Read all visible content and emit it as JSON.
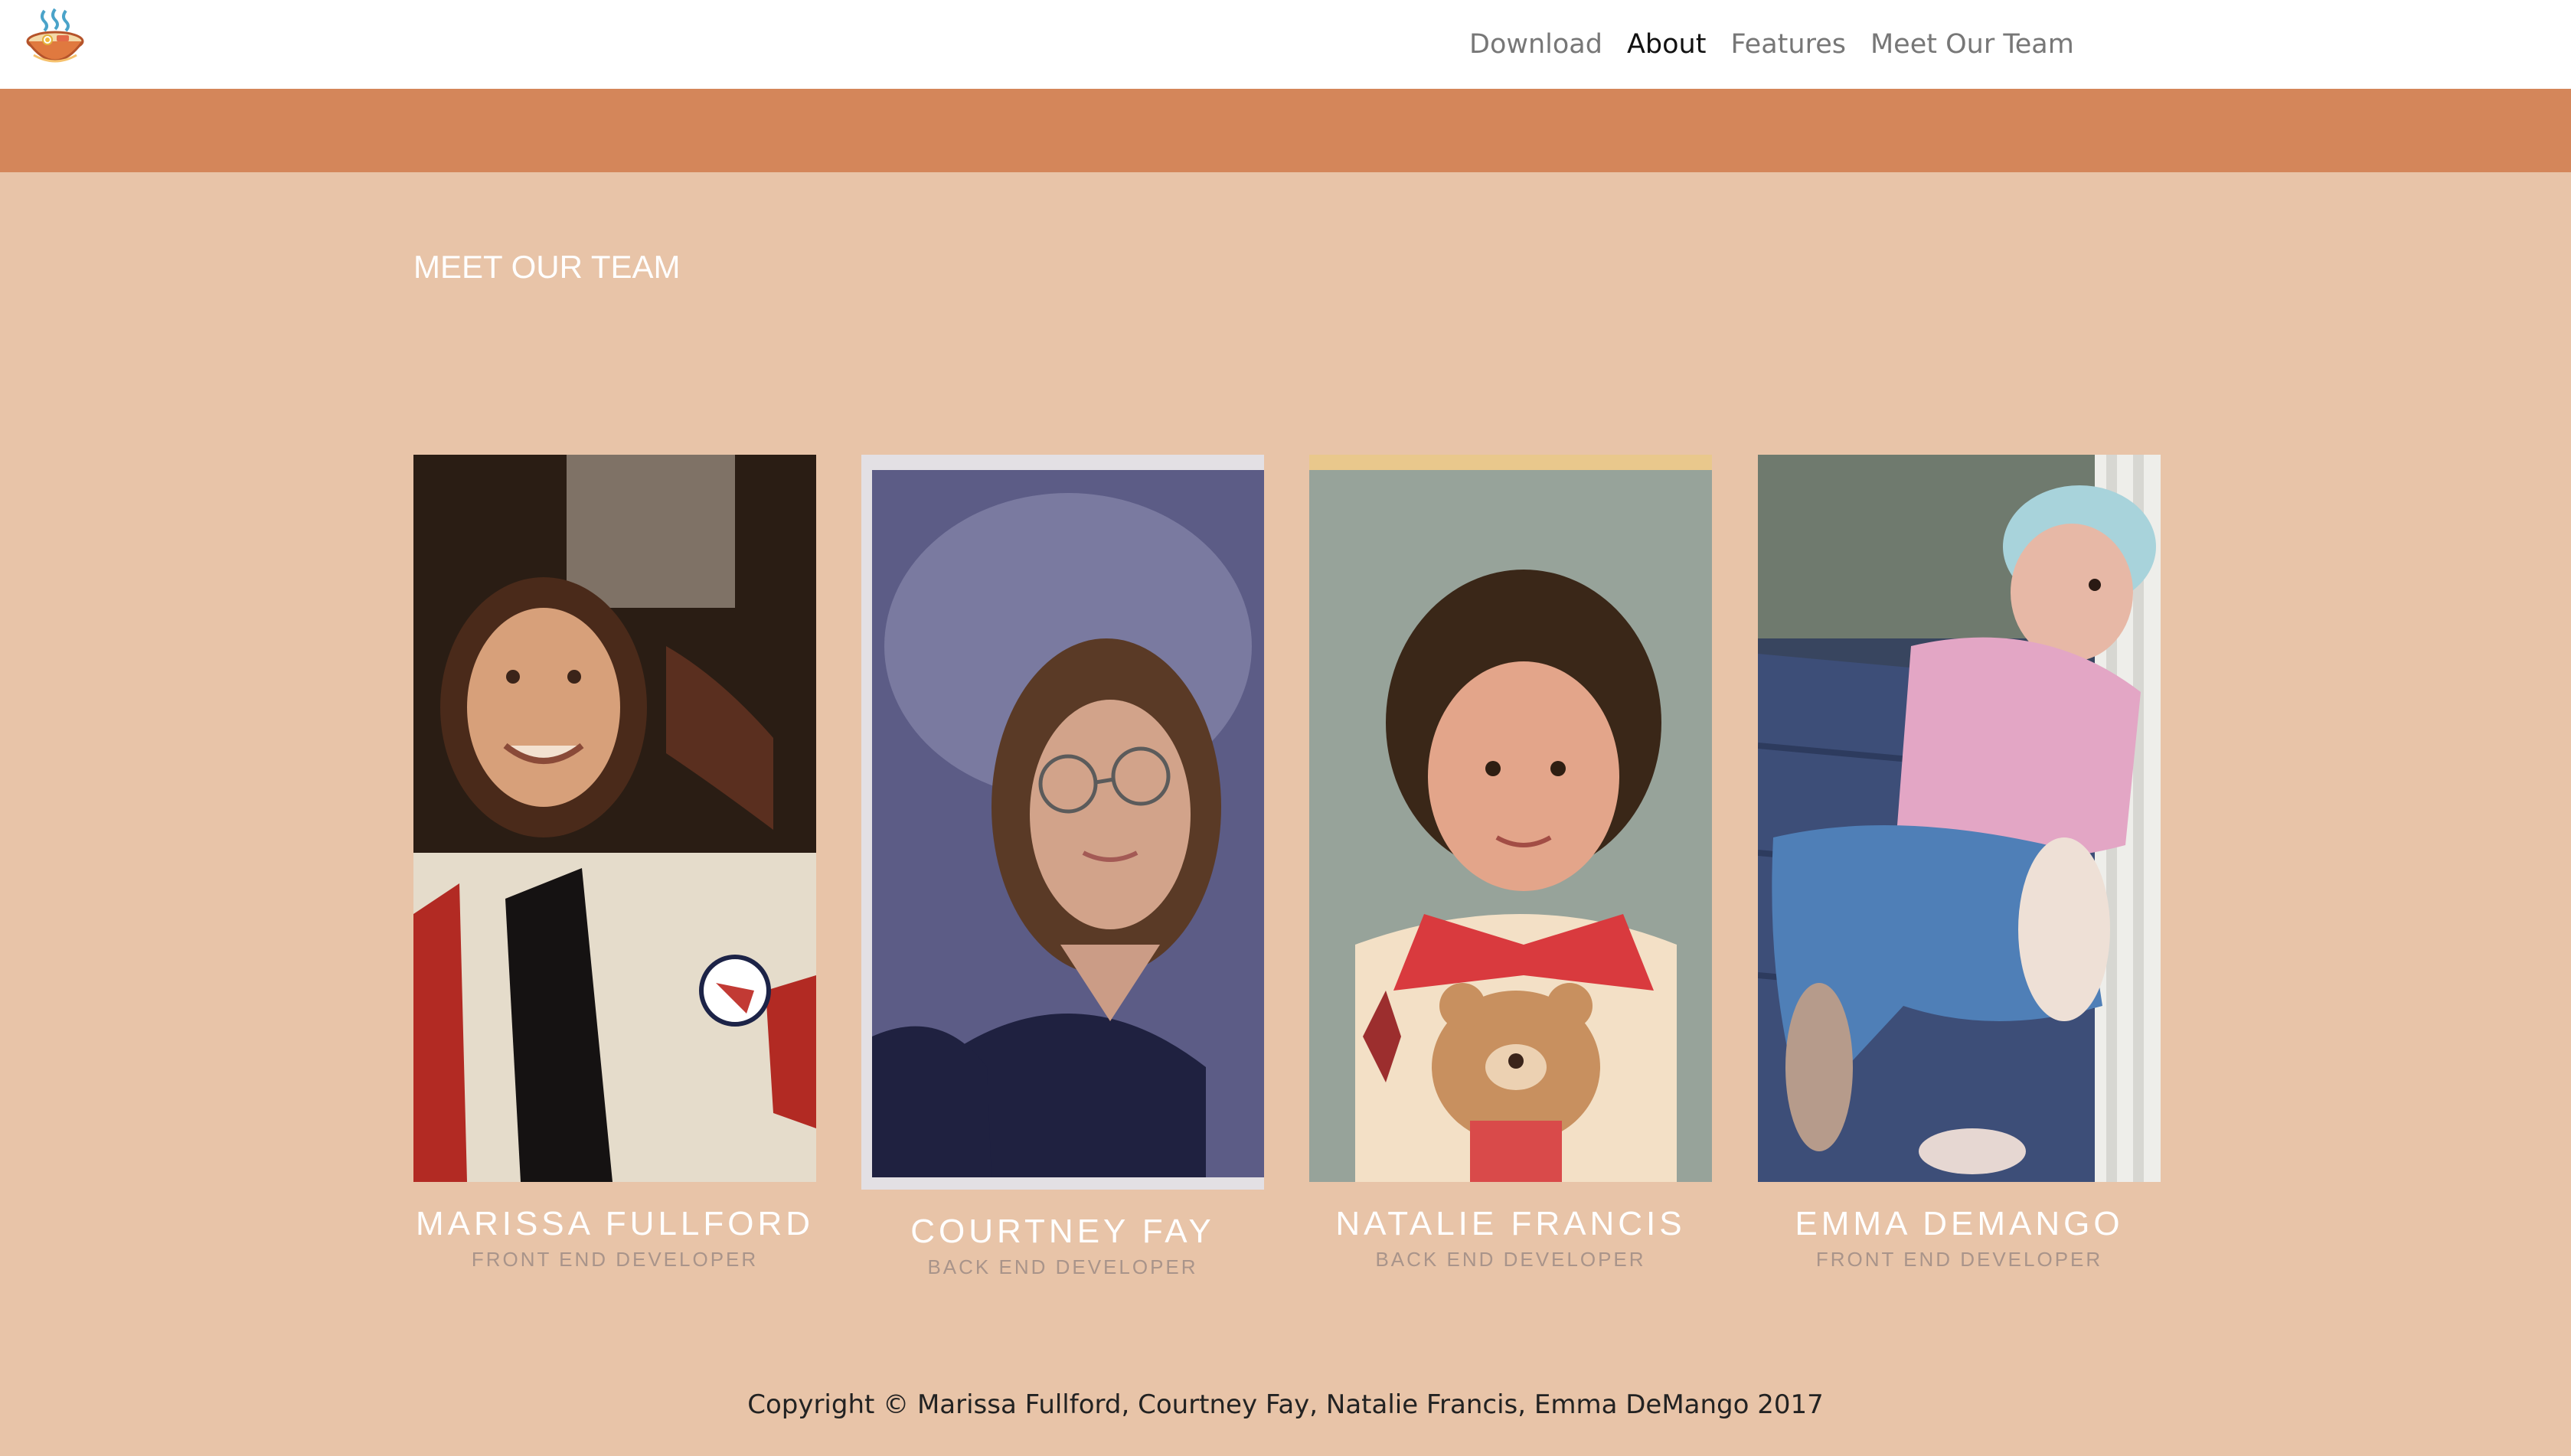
{
  "nav": {
    "logo_icon": "ramen-bowl-icon",
    "links": [
      {
        "label": "Download",
        "active": false
      },
      {
        "label": "About",
        "active": true
      },
      {
        "label": "Features",
        "active": false
      },
      {
        "label": "Meet Our Team",
        "active": false
      }
    ]
  },
  "section": {
    "title": "MEET OUR TEAM"
  },
  "team": [
    {
      "name": "MARISSA FULLFORD",
      "role": "FRONT END DEVELOPER"
    },
    {
      "name": "COURTNEY FAY",
      "role": "BACK END DEVELOPER"
    },
    {
      "name": "NATALIE FRANCIS",
      "role": "BACK END DEVELOPER"
    },
    {
      "name": "EMMA DEMANGO",
      "role": "FRONT END DEVELOPER"
    }
  ],
  "footer": {
    "copyright": "Copyright © Marissa Fullford, Courtney Fay, Natalie Francis, Emma DeMango 2017"
  },
  "colors": {
    "background": "#e8c4a8",
    "banner": "#d4865a",
    "navbar": "#ffffff"
  }
}
